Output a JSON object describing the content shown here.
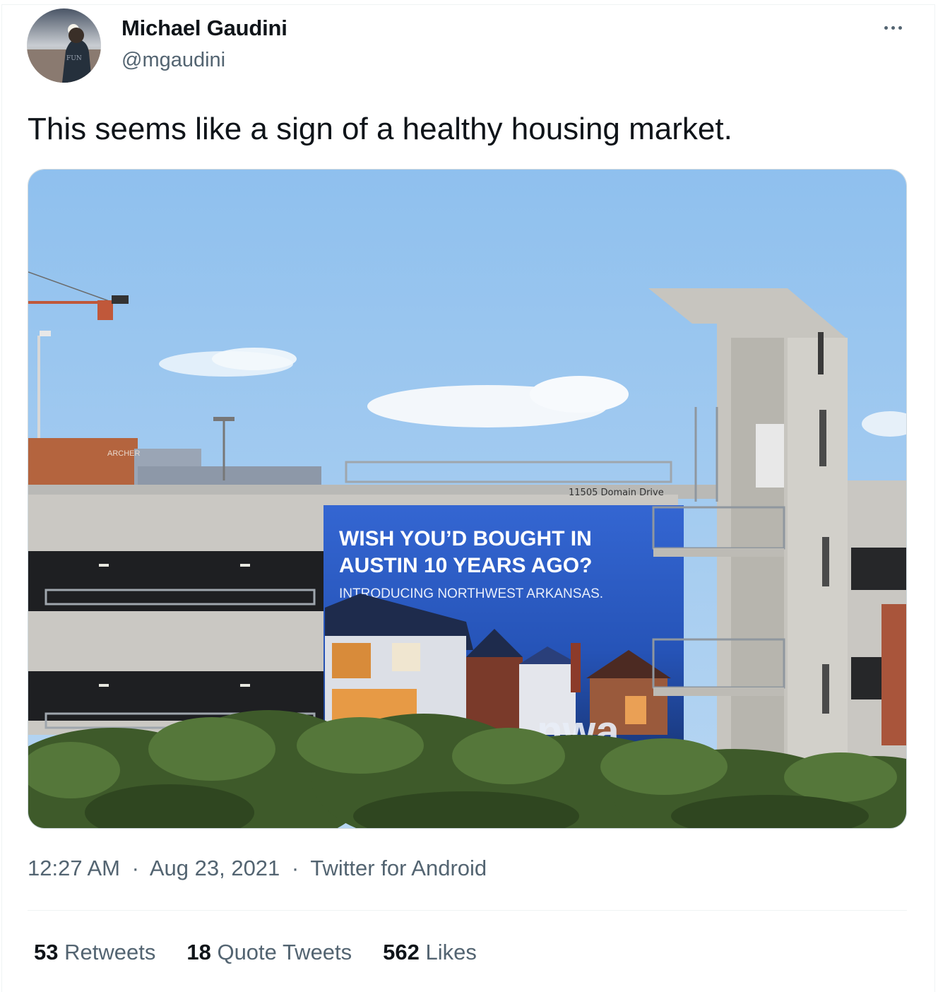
{
  "author": {
    "name": "Michael Gaudini",
    "handle": "@mgaudini"
  },
  "tweet": {
    "text": "This seems like a sign of a healthy housing market."
  },
  "photo": {
    "address": "11505 Domain Drive",
    "billboard_line1": "WISH YOU’D BOUGHT IN",
    "billboard_line2": "AUSTIN 10 YEARS AGO?",
    "billboard_line3": "INTRODUCING NORTHWEST ARKANSAS.",
    "building_sign": "ARCHER",
    "logo_fragment": "nwa"
  },
  "meta": {
    "time": "12:27 AM",
    "separator": "·",
    "date": "Aug 23, 2021",
    "client": "Twitter for Android"
  },
  "stats": {
    "retweets_count": "53",
    "retweets_label": "Retweets",
    "quotes_count": "18",
    "quotes_label": "Quote Tweets",
    "likes_count": "562",
    "likes_label": "Likes"
  },
  "colors": {
    "text_primary": "#0f1419",
    "text_secondary": "#536471",
    "border": "#cfd9de",
    "billboard_blue": "#2f62c8"
  },
  "icons": [
    "more-options-icon"
  ]
}
